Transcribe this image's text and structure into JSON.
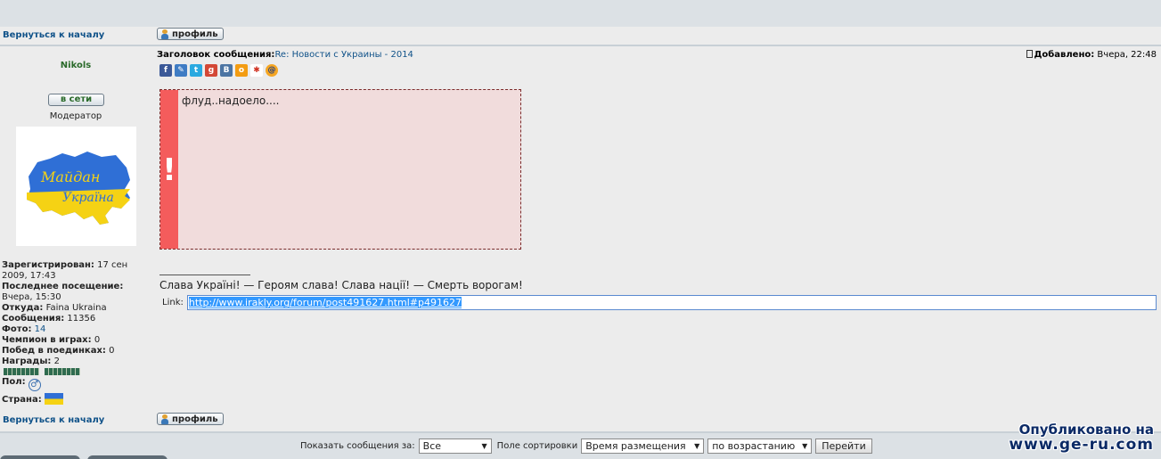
{
  "nav": {
    "back_to_top": "Вернуться к началу",
    "profile_button": "профиль"
  },
  "author": {
    "username": "Nikols",
    "status": "в сети",
    "role": "Модератор",
    "registered_label": "Зарегистрирован:",
    "registered_value": "17 сен 2009, 17:43",
    "last_visit_label": "Последнее посещение:",
    "last_visit_value": "Вчера, 15:30",
    "from_label": "Откуда:",
    "from_value": "Faina Ukraina",
    "messages_label": "Сообщения:",
    "messages_value": "11356",
    "photos_label": "Фото:",
    "photos_value": "14",
    "games_label": "Чемпион в играх:",
    "games_value": "0",
    "duels_label": "Побед в поединках:",
    "duels_value": "0",
    "awards_label": "Награды:",
    "awards_value": "2",
    "gender_label": "Пол:",
    "country_label": "Страна:",
    "avatar_text": "Майдан Україна"
  },
  "post": {
    "subject_label": "Заголовок сообщения:",
    "subject_value": "Re: Новости с Украины - 2014",
    "added_label": "Добавлено:",
    "added_value": "Вчера, 22:48",
    "share_icons": [
      "facebook-icon",
      "livejournal-icon",
      "twitter-icon",
      "googleplus-icon",
      "vkontakte-icon",
      "odnoklassniki-icon",
      "myworld-icon",
      "mailru-icon"
    ],
    "flood_text": "флуд..надоело....",
    "flood_mark": "!",
    "signature": "Слава Україні! — Героям слава! Слава нації! — Смерть ворогам!",
    "link_label": "Link:",
    "link_value": "http://www.irakly.org/forum/post491627.html#p491627"
  },
  "filters": {
    "show_label": "Показать сообщения за:",
    "show_value": "Все",
    "sort_label": "Поле сортировки",
    "sort_value": "Время размещения",
    "order_value": "по возрастанию",
    "go_button": "Перейти"
  },
  "watermark": {
    "line1": "Опубликовано на",
    "line2": "www.ge-ru.com"
  },
  "colors": {
    "link": "#105289",
    "username": "#2a6a2a",
    "flood_bg": "#f1dcdc",
    "flood_bar": "#f45c5c"
  }
}
